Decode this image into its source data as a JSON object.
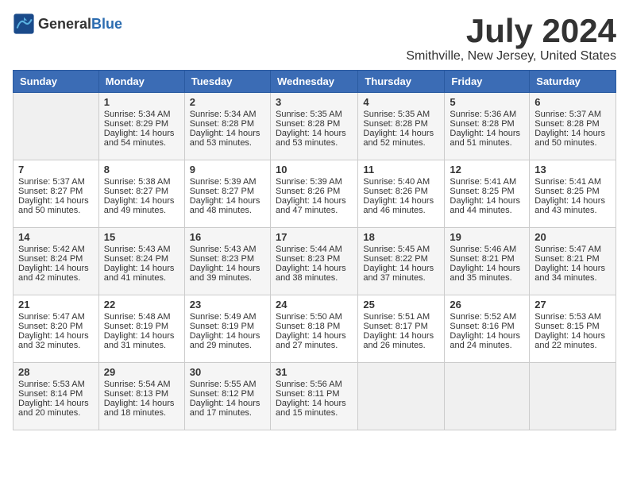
{
  "header": {
    "logo_general": "General",
    "logo_blue": "Blue",
    "month": "July 2024",
    "location": "Smithville, New Jersey, United States"
  },
  "days_of_week": [
    "Sunday",
    "Monday",
    "Tuesday",
    "Wednesday",
    "Thursday",
    "Friday",
    "Saturday"
  ],
  "weeks": [
    [
      {
        "day": "",
        "sunrise": "",
        "sunset": "",
        "daylight": ""
      },
      {
        "day": "1",
        "sunrise": "Sunrise: 5:34 AM",
        "sunset": "Sunset: 8:29 PM",
        "daylight": "Daylight: 14 hours and 54 minutes."
      },
      {
        "day": "2",
        "sunrise": "Sunrise: 5:34 AM",
        "sunset": "Sunset: 8:28 PM",
        "daylight": "Daylight: 14 hours and 53 minutes."
      },
      {
        "day": "3",
        "sunrise": "Sunrise: 5:35 AM",
        "sunset": "Sunset: 8:28 PM",
        "daylight": "Daylight: 14 hours and 53 minutes."
      },
      {
        "day": "4",
        "sunrise": "Sunrise: 5:35 AM",
        "sunset": "Sunset: 8:28 PM",
        "daylight": "Daylight: 14 hours and 52 minutes."
      },
      {
        "day": "5",
        "sunrise": "Sunrise: 5:36 AM",
        "sunset": "Sunset: 8:28 PM",
        "daylight": "Daylight: 14 hours and 51 minutes."
      },
      {
        "day": "6",
        "sunrise": "Sunrise: 5:37 AM",
        "sunset": "Sunset: 8:28 PM",
        "daylight": "Daylight: 14 hours and 50 minutes."
      }
    ],
    [
      {
        "day": "7",
        "sunrise": "Sunrise: 5:37 AM",
        "sunset": "Sunset: 8:27 PM",
        "daylight": "Daylight: 14 hours and 50 minutes."
      },
      {
        "day": "8",
        "sunrise": "Sunrise: 5:38 AM",
        "sunset": "Sunset: 8:27 PM",
        "daylight": "Daylight: 14 hours and 49 minutes."
      },
      {
        "day": "9",
        "sunrise": "Sunrise: 5:39 AM",
        "sunset": "Sunset: 8:27 PM",
        "daylight": "Daylight: 14 hours and 48 minutes."
      },
      {
        "day": "10",
        "sunrise": "Sunrise: 5:39 AM",
        "sunset": "Sunset: 8:26 PM",
        "daylight": "Daylight: 14 hours and 47 minutes."
      },
      {
        "day": "11",
        "sunrise": "Sunrise: 5:40 AM",
        "sunset": "Sunset: 8:26 PM",
        "daylight": "Daylight: 14 hours and 46 minutes."
      },
      {
        "day": "12",
        "sunrise": "Sunrise: 5:41 AM",
        "sunset": "Sunset: 8:25 PM",
        "daylight": "Daylight: 14 hours and 44 minutes."
      },
      {
        "day": "13",
        "sunrise": "Sunrise: 5:41 AM",
        "sunset": "Sunset: 8:25 PM",
        "daylight": "Daylight: 14 hours and 43 minutes."
      }
    ],
    [
      {
        "day": "14",
        "sunrise": "Sunrise: 5:42 AM",
        "sunset": "Sunset: 8:24 PM",
        "daylight": "Daylight: 14 hours and 42 minutes."
      },
      {
        "day": "15",
        "sunrise": "Sunrise: 5:43 AM",
        "sunset": "Sunset: 8:24 PM",
        "daylight": "Daylight: 14 hours and 41 minutes."
      },
      {
        "day": "16",
        "sunrise": "Sunrise: 5:43 AM",
        "sunset": "Sunset: 8:23 PM",
        "daylight": "Daylight: 14 hours and 39 minutes."
      },
      {
        "day": "17",
        "sunrise": "Sunrise: 5:44 AM",
        "sunset": "Sunset: 8:23 PM",
        "daylight": "Daylight: 14 hours and 38 minutes."
      },
      {
        "day": "18",
        "sunrise": "Sunrise: 5:45 AM",
        "sunset": "Sunset: 8:22 PM",
        "daylight": "Daylight: 14 hours and 37 minutes."
      },
      {
        "day": "19",
        "sunrise": "Sunrise: 5:46 AM",
        "sunset": "Sunset: 8:21 PM",
        "daylight": "Daylight: 14 hours and 35 minutes."
      },
      {
        "day": "20",
        "sunrise": "Sunrise: 5:47 AM",
        "sunset": "Sunset: 8:21 PM",
        "daylight": "Daylight: 14 hours and 34 minutes."
      }
    ],
    [
      {
        "day": "21",
        "sunrise": "Sunrise: 5:47 AM",
        "sunset": "Sunset: 8:20 PM",
        "daylight": "Daylight: 14 hours and 32 minutes."
      },
      {
        "day": "22",
        "sunrise": "Sunrise: 5:48 AM",
        "sunset": "Sunset: 8:19 PM",
        "daylight": "Daylight: 14 hours and 31 minutes."
      },
      {
        "day": "23",
        "sunrise": "Sunrise: 5:49 AM",
        "sunset": "Sunset: 8:19 PM",
        "daylight": "Daylight: 14 hours and 29 minutes."
      },
      {
        "day": "24",
        "sunrise": "Sunrise: 5:50 AM",
        "sunset": "Sunset: 8:18 PM",
        "daylight": "Daylight: 14 hours and 27 minutes."
      },
      {
        "day": "25",
        "sunrise": "Sunrise: 5:51 AM",
        "sunset": "Sunset: 8:17 PM",
        "daylight": "Daylight: 14 hours and 26 minutes."
      },
      {
        "day": "26",
        "sunrise": "Sunrise: 5:52 AM",
        "sunset": "Sunset: 8:16 PM",
        "daylight": "Daylight: 14 hours and 24 minutes."
      },
      {
        "day": "27",
        "sunrise": "Sunrise: 5:53 AM",
        "sunset": "Sunset: 8:15 PM",
        "daylight": "Daylight: 14 hours and 22 minutes."
      }
    ],
    [
      {
        "day": "28",
        "sunrise": "Sunrise: 5:53 AM",
        "sunset": "Sunset: 8:14 PM",
        "daylight": "Daylight: 14 hours and 20 minutes."
      },
      {
        "day": "29",
        "sunrise": "Sunrise: 5:54 AM",
        "sunset": "Sunset: 8:13 PM",
        "daylight": "Daylight: 14 hours and 18 minutes."
      },
      {
        "day": "30",
        "sunrise": "Sunrise: 5:55 AM",
        "sunset": "Sunset: 8:12 PM",
        "daylight": "Daylight: 14 hours and 17 minutes."
      },
      {
        "day": "31",
        "sunrise": "Sunrise: 5:56 AM",
        "sunset": "Sunset: 8:11 PM",
        "daylight": "Daylight: 14 hours and 15 minutes."
      },
      {
        "day": "",
        "sunrise": "",
        "sunset": "",
        "daylight": ""
      },
      {
        "day": "",
        "sunrise": "",
        "sunset": "",
        "daylight": ""
      },
      {
        "day": "",
        "sunrise": "",
        "sunset": "",
        "daylight": ""
      }
    ]
  ]
}
